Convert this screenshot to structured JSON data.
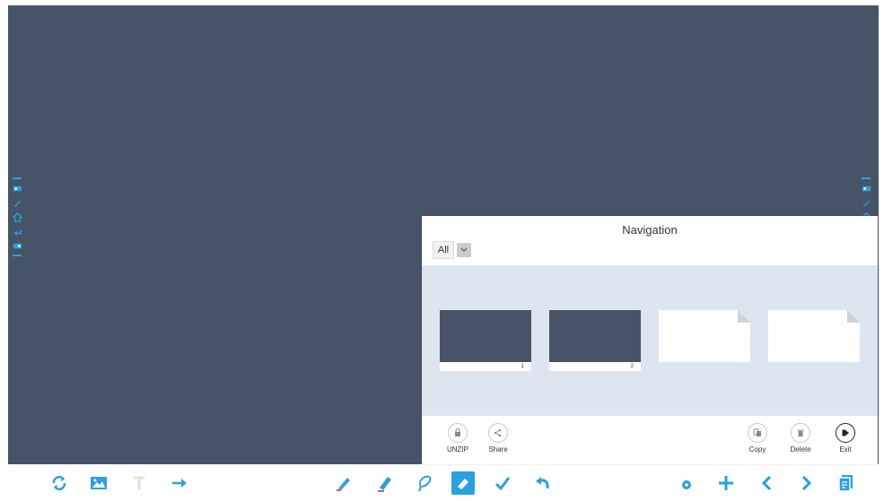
{
  "colors": {
    "canvas": "#475467",
    "accent": "#2aa0de",
    "panel": "#ffffff",
    "strip": "#dde5f0"
  },
  "left_sidebar": {
    "icons": [
      "projector-icon",
      "pen-icon",
      "home-icon",
      "undo-icon",
      "projector-icon"
    ]
  },
  "right_sidebar": {
    "icons": [
      "projector-icon",
      "pen-icon",
      "home-icon",
      "undo-icon",
      "projector-icon"
    ]
  },
  "navigation": {
    "title": "Navigation",
    "filter": {
      "selected": "All"
    },
    "pages": [
      {
        "number": "1",
        "type": "canvas"
      },
      {
        "number": "2",
        "type": "canvas"
      },
      {
        "number": "",
        "type": "blank"
      },
      {
        "number": "",
        "type": "blank"
      }
    ],
    "actions": {
      "unlock": "UNZIP",
      "share": "Share",
      "copy": "Copy",
      "delete": "Delete",
      "exit": "Exit"
    }
  },
  "toolbar": {
    "left": [
      "refresh-icon",
      "image-icon",
      "text-icon",
      "arrow-icon"
    ],
    "center": [
      "pen-icon",
      "highlighter-icon",
      "lasso-icon",
      "eraser-icon",
      "check-icon",
      "undo-icon"
    ],
    "center_active": "eraser-icon",
    "right": [
      "settings-icon",
      "add-page-icon",
      "prev-page-icon",
      "next-page-icon",
      "pages-icon"
    ]
  }
}
